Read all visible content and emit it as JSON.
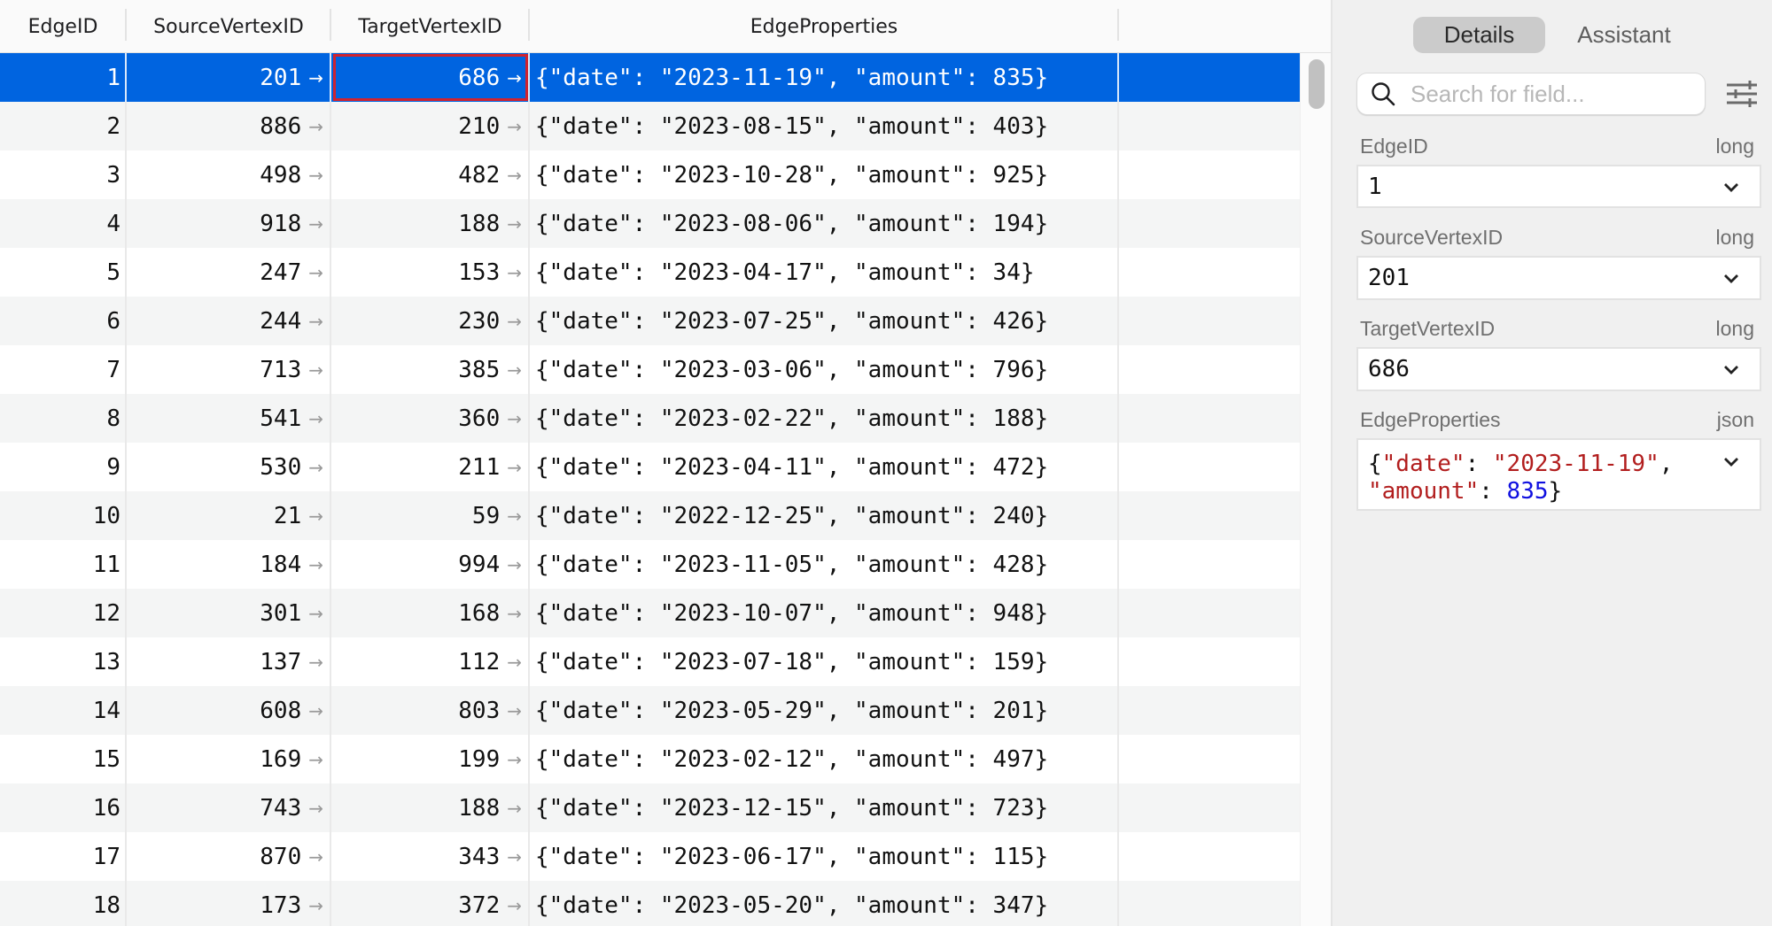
{
  "table": {
    "columns": [
      "EdgeID",
      "SourceVertexID",
      "TargetVertexID",
      "EdgeProperties"
    ],
    "selected_row_index": 0,
    "focused_column": "TargetVertexID",
    "link_arrow_glyph": "→",
    "rows": [
      {
        "EdgeID": "1",
        "SourceVertexID": "201",
        "TargetVertexID": "686",
        "EdgeProperties": "{\"date\": \"2023-11-19\", \"amount\": 835}"
      },
      {
        "EdgeID": "2",
        "SourceVertexID": "886",
        "TargetVertexID": "210",
        "EdgeProperties": "{\"date\": \"2023-08-15\", \"amount\": 403}"
      },
      {
        "EdgeID": "3",
        "SourceVertexID": "498",
        "TargetVertexID": "482",
        "EdgeProperties": "{\"date\": \"2023-10-28\", \"amount\": 925}"
      },
      {
        "EdgeID": "4",
        "SourceVertexID": "918",
        "TargetVertexID": "188",
        "EdgeProperties": "{\"date\": \"2023-08-06\", \"amount\": 194}"
      },
      {
        "EdgeID": "5",
        "SourceVertexID": "247",
        "TargetVertexID": "153",
        "EdgeProperties": "{\"date\": \"2023-04-17\", \"amount\": 34}"
      },
      {
        "EdgeID": "6",
        "SourceVertexID": "244",
        "TargetVertexID": "230",
        "EdgeProperties": "{\"date\": \"2023-07-25\", \"amount\": 426}"
      },
      {
        "EdgeID": "7",
        "SourceVertexID": "713",
        "TargetVertexID": "385",
        "EdgeProperties": "{\"date\": \"2023-03-06\", \"amount\": 796}"
      },
      {
        "EdgeID": "8",
        "SourceVertexID": "541",
        "TargetVertexID": "360",
        "EdgeProperties": "{\"date\": \"2023-02-22\", \"amount\": 188}"
      },
      {
        "EdgeID": "9",
        "SourceVertexID": "530",
        "TargetVertexID": "211",
        "EdgeProperties": "{\"date\": \"2023-04-11\", \"amount\": 472}"
      },
      {
        "EdgeID": "10",
        "SourceVertexID": "21",
        "TargetVertexID": "59",
        "EdgeProperties": "{\"date\": \"2022-12-25\", \"amount\": 240}"
      },
      {
        "EdgeID": "11",
        "SourceVertexID": "184",
        "TargetVertexID": "994",
        "EdgeProperties": "{\"date\": \"2023-11-05\", \"amount\": 428}"
      },
      {
        "EdgeID": "12",
        "SourceVertexID": "301",
        "TargetVertexID": "168",
        "EdgeProperties": "{\"date\": \"2023-10-07\", \"amount\": 948}"
      },
      {
        "EdgeID": "13",
        "SourceVertexID": "137",
        "TargetVertexID": "112",
        "EdgeProperties": "{\"date\": \"2023-07-18\", \"amount\": 159}"
      },
      {
        "EdgeID": "14",
        "SourceVertexID": "608",
        "TargetVertexID": "803",
        "EdgeProperties": "{\"date\": \"2023-05-29\", \"amount\": 201}"
      },
      {
        "EdgeID": "15",
        "SourceVertexID": "169",
        "TargetVertexID": "199",
        "EdgeProperties": "{\"date\": \"2023-02-12\", \"amount\": 497}"
      },
      {
        "EdgeID": "16",
        "SourceVertexID": "743",
        "TargetVertexID": "188",
        "EdgeProperties": "{\"date\": \"2023-12-15\", \"amount\": 723}"
      },
      {
        "EdgeID": "17",
        "SourceVertexID": "870",
        "TargetVertexID": "343",
        "EdgeProperties": "{\"date\": \"2023-06-17\", \"amount\": 115}"
      },
      {
        "EdgeID": "18",
        "SourceVertexID": "173",
        "TargetVertexID": "372",
        "EdgeProperties": "{\"date\": \"2023-05-20\", \"amount\": 347}"
      }
    ]
  },
  "panel": {
    "tabs": [
      {
        "label": "Details",
        "active": true
      },
      {
        "label": "Assistant",
        "active": false
      }
    ],
    "search": {
      "placeholder": "Search for field...",
      "value": ""
    },
    "fields": [
      {
        "name": "EdgeID",
        "type": "long",
        "value": "1"
      },
      {
        "name": "SourceVertexID",
        "type": "long",
        "value": "201"
      },
      {
        "name": "TargetVertexID",
        "type": "long",
        "value": "686"
      },
      {
        "name": "EdgeProperties",
        "type": "json",
        "json": [
          {
            "t": "p",
            "v": "{"
          },
          {
            "t": "k",
            "v": "\"date\""
          },
          {
            "t": "p",
            "v": ": "
          },
          {
            "t": "s",
            "v": "\"2023-11-19\""
          },
          {
            "t": "p",
            "v": ",\n"
          },
          {
            "t": "k",
            "v": "\"amount\""
          },
          {
            "t": "p",
            "v": ": "
          },
          {
            "t": "n",
            "v": "835"
          },
          {
            "t": "p",
            "v": "}"
          }
        ]
      }
    ]
  },
  "colors": {
    "selection": "#0064e0",
    "focus_border": "#d0232f",
    "json_string": "#b21e1e",
    "json_number": "#1010e0"
  }
}
